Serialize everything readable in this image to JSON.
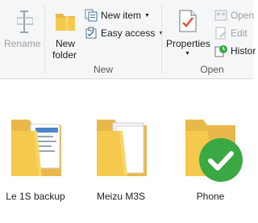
{
  "ribbon": {
    "rename_label": "Rename",
    "new_folder_label": "New folder",
    "new_folder_line1": "New",
    "new_folder_line2": "folder",
    "new_item_label": "New item",
    "easy_access_label": "Easy access",
    "new_group_label": "New",
    "properties_label": "Properties",
    "open_label": "Open",
    "edit_label": "Edit",
    "history_label": "Histor",
    "open_group_label": "Open"
  },
  "folders": [
    {
      "name": "Le 1S backup"
    },
    {
      "name": "Meizu M3S"
    },
    {
      "name": "Phone"
    }
  ],
  "colors": {
    "folder_yellow": "#f5c94c",
    "folder_back": "#e8b84a",
    "check_green": "#3aa843",
    "properties_red": "#e1533f"
  }
}
